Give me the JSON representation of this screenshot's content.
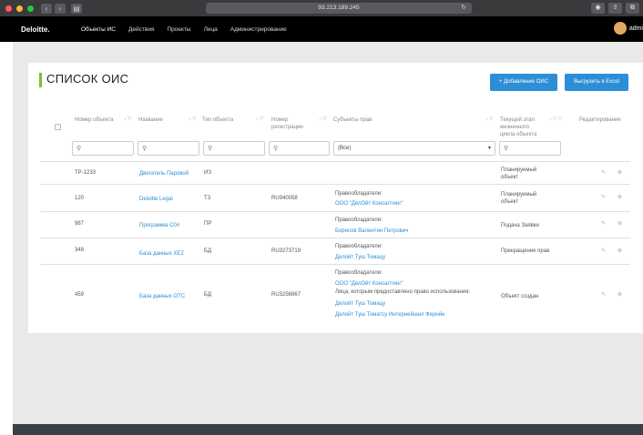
{
  "browser": {
    "url": "93.213.189.245",
    "back_icon": "‹",
    "forward_icon": "›",
    "sidebar_icon": "▤",
    "reload_icon": "↻",
    "right_icons": [
      "◉",
      "⇪",
      "⧉"
    ]
  },
  "navbar": {
    "brand": "Deloitte.",
    "items": [
      {
        "label": "Объекты ИС",
        "active": true
      },
      {
        "label": "Действия"
      },
      {
        "label": "Проекты"
      },
      {
        "label": "Лица"
      },
      {
        "label": "Администрирование"
      }
    ],
    "user": "admi"
  },
  "page": {
    "title": "СПИСОК ОИС",
    "add_button": "+ Добавление ОИС",
    "export_button": "Выгрузить в Excel"
  },
  "table": {
    "columns": [
      {
        "label": "Номер объекта",
        "sort": "↓ ▽"
      },
      {
        "label": "Название",
        "sort": "↓ ▽"
      },
      {
        "label": "Тип объекта",
        "sort": "↓ ▽"
      },
      {
        "label": "Номер регистрации",
        "sort": "↓ ▽"
      },
      {
        "label": "Субъекты прав",
        "sort": "↓ ▽"
      },
      {
        "label": "Текущий этап жизненного цикла объекта",
        "sort": "↓ ▽ ▽"
      },
      {
        "label": "Редактирование"
      }
    ],
    "filters": {
      "search_icon": "⚲",
      "subject_select": "(Все)",
      "caret": "▾"
    },
    "rows": [
      {
        "number": "TP-1233",
        "name": "Двигатель Паровой",
        "type": "ИЗ",
        "reg": "",
        "subjects": [],
        "stage": "Планируемый объект"
      },
      {
        "number": "120",
        "name": "Deloitte Legal",
        "type": "ТЗ",
        "reg": "RU940058",
        "subjects": [
          {
            "t": "Правообладатели:",
            "link": false
          },
          {
            "t": "ООО \"ДелОйт Консалтинг\"",
            "link": true
          }
        ],
        "stage": "Планируемый объект"
      },
      {
        "number": "987",
        "name": "Программа C0#",
        "type": "ПР",
        "reg": "",
        "subjects": [
          {
            "t": "Правообладатели:",
            "link": false
          },
          {
            "t": "Борисов Валентин Петрович",
            "link": true
          }
        ],
        "stage": "Подача Заявки"
      },
      {
        "number": "348",
        "name": "База данных XEZ",
        "type": "БД",
        "reg": "RU3273719",
        "subjects": [
          {
            "t": "Правообладатели:",
            "link": false
          },
          {
            "t": "Делойт Туш Томацу",
            "link": true
          }
        ],
        "stage": "Прекращение прав"
      },
      {
        "number": "459",
        "name": "База данных ОТС",
        "type": "БД",
        "reg": "RU3256867",
        "subjects": [
          {
            "t": "Правообладатели:",
            "link": false
          },
          {
            "t": "ООО \"ДелОйт Консалтинг\"",
            "link": true
          },
          {
            "t": "Лица, которым предоставлено право использования:",
            "link": false
          },
          {
            "t": "Делойт Туш Томацу",
            "link": true
          },
          {
            "t": "Делойт Туш Томатсу Интернейшнл Фернйн",
            "link": true
          }
        ],
        "stage": "Объект создан"
      }
    ],
    "edit_icon": "✎",
    "delete_icon": "⊗"
  }
}
